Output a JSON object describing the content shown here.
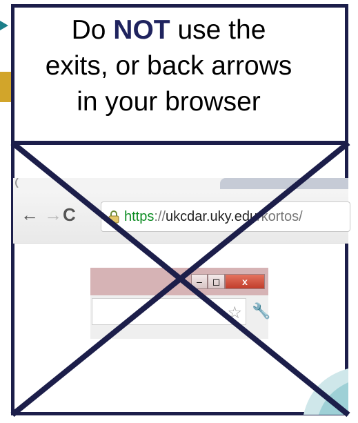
{
  "slide": {
    "heading": {
      "prefix": "Do ",
      "emphasis": "NOT",
      "line1_rest": " use the",
      "line2": "exits, or back arrows",
      "line3": "in your browser"
    },
    "browser": {
      "back_glyph": "←",
      "forward_glyph": "→",
      "reload_glyph": "C",
      "url_scheme": "https",
      "url_separator": "://",
      "url_domain": "ukcdar.uky.edu",
      "url_path": "/kortos/"
    },
    "window": {
      "minimize_glyph": "–",
      "maximize_glyph": "◻",
      "close_glyph": "x",
      "star_glyph": "☆",
      "wrench_glyph": "🔧"
    }
  },
  "colors": {
    "border_navy": "#1c1e4a",
    "emphasis_navy": "#1f235e",
    "https_green": "#0b8b21",
    "title_bar_pink": "#d6b3b5",
    "close_red": "#c13d2b",
    "outer_gold": "#d2a52a",
    "outer_teal": "#1b7f8a",
    "leaf_teal": "#cfe7ea"
  },
  "icons": [
    "back-arrow-icon",
    "forward-arrow-icon",
    "reload-icon",
    "lock-icon",
    "minimize-icon",
    "maximize-icon",
    "close-icon",
    "star-icon",
    "wrench-icon",
    "cross-out-mark"
  ]
}
